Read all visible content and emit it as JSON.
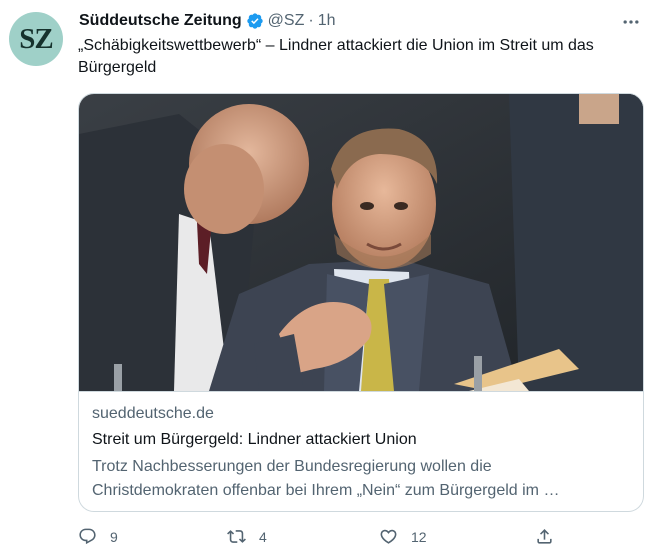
{
  "author": {
    "avatar_text": "SZ",
    "name": "Süddeutsche Zeitung",
    "handle": "@SZ",
    "separator": "·",
    "time": "1h",
    "verified_color": "#1d9bf0"
  },
  "tweet": {
    "text": "„Schäbigkeitswettbewerb“ – Lindner attackiert die Union im Streit um das Bürgergeld"
  },
  "card": {
    "image_icon": "press-photo",
    "domain": "sueddeutsche.de",
    "title": "Streit um Bürgergeld: Lindner attackiert Union",
    "description": "Trotz Nachbesserungen der Bundesregierung wollen die Christdemokraten offenbar bei Ihrem „Nein“ zum Bürgergeld im …"
  },
  "actions": {
    "reply_count": "9",
    "retweet_count": "4",
    "like_count": "12",
    "icons": [
      "reply-icon",
      "retweet-icon",
      "like-icon",
      "share-icon"
    ]
  },
  "colors": {
    "text_primary": "#0f1419",
    "text_secondary": "#536471",
    "border": "#cfd9de",
    "avatar_bg": "#9fd0c8"
  }
}
